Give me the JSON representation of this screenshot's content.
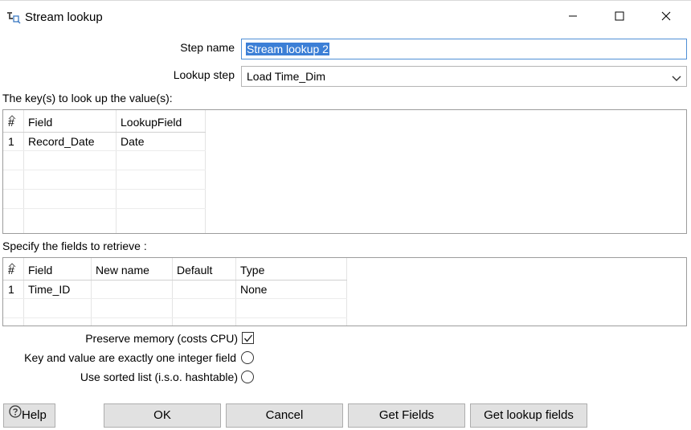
{
  "window": {
    "title": "Stream lookup"
  },
  "form": {
    "step_name_label": "Step name",
    "step_name_value": "Stream lookup 2",
    "lookup_step_label": "Lookup step",
    "lookup_step_value": "Load Time_Dim"
  },
  "keys_section": {
    "label": "The key(s) to look up the value(s):",
    "columns": [
      "#",
      "Field",
      "LookupField"
    ],
    "rows": [
      [
        "1",
        "Record_Date",
        "Date"
      ]
    ]
  },
  "retrieve_section": {
    "label": "Specify the fields to retrieve :",
    "columns": [
      "#",
      "Field",
      "New name",
      "Default",
      "Type"
    ],
    "rows": [
      [
        "1",
        "Time_ID",
        "",
        "",
        "None"
      ]
    ]
  },
  "options": {
    "preserve_memory_label": "Preserve memory (costs CPU)",
    "preserve_memory_checked": true,
    "integer_pair_label": "Key and value are exactly one integer field",
    "integer_pair_selected": false,
    "sorted_list_label": "Use sorted list (i.s.o. hashtable)",
    "sorted_list_selected": false
  },
  "buttons": {
    "help": "Help",
    "ok": "OK",
    "cancel": "Cancel",
    "get_fields": "Get Fields",
    "get_lookup_fields": "Get lookup fields"
  },
  "icons": {
    "app": "stream-lookup-icon",
    "minimize": "minimize-icon",
    "maximize": "maximize-icon",
    "close": "close-icon",
    "dropdown": "chevron-down-icon",
    "help": "question-circle-icon"
  }
}
